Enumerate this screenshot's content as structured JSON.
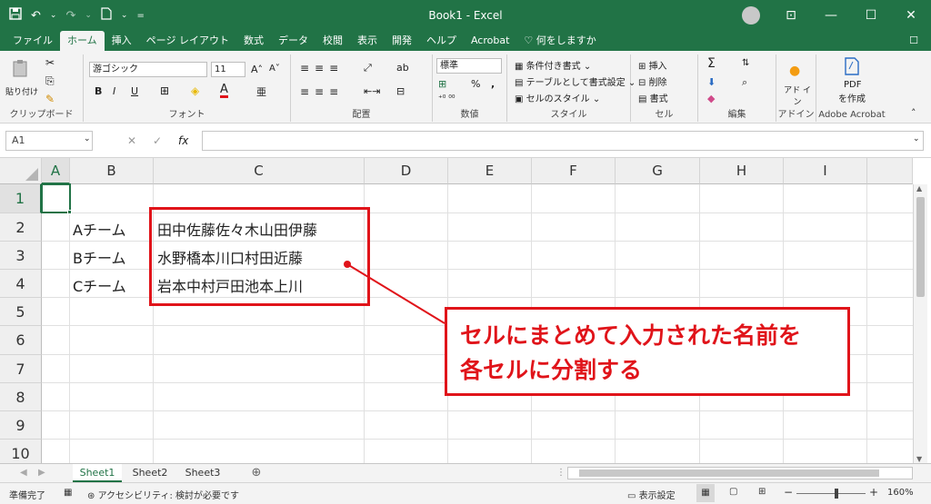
{
  "title_bar": {
    "title": "Book1  -  Excel",
    "minimize": "—",
    "restore": "☐",
    "close": "✕",
    "ribbon_display": "⊡"
  },
  "tabs": [
    "ファイル",
    "ホーム",
    "挿入",
    "ページ レイアウト",
    "数式",
    "データ",
    "校閲",
    "表示",
    "開発",
    "ヘルプ",
    "Acrobat"
  ],
  "tell_me": "何をしますか",
  "ribbon": {
    "clipboard": {
      "label": "クリップボード",
      "paste": "貼り付け"
    },
    "font": {
      "label": "フォント",
      "name": "游ゴシック",
      "size": "11",
      "bold": "B",
      "italic": "I",
      "underline": "U",
      "grow": "A˄",
      "shrink": "A˅"
    },
    "alignment": {
      "label": "配置"
    },
    "number": {
      "label": "数値",
      "format": "標準",
      "percent": "%",
      "comma": ","
    },
    "styles": {
      "label": "スタイル",
      "conditional": "条件付き書式",
      "table": "テーブルとして書式設定",
      "cell_styles": "セルのスタイル"
    },
    "cells": {
      "label": "セル",
      "insert": "挿入",
      "delete": "削除",
      "format": "書式"
    },
    "editing": {
      "label": "編集",
      "sum": "Σ"
    },
    "addins": {
      "label": "アドイン",
      "text": "アド イン"
    },
    "acrobat": {
      "label": "Adobe Acrobat",
      "pdf": "PDF",
      "create": "を作成"
    }
  },
  "formula_bar": {
    "name_box": "A1",
    "fx": "fx",
    "cancel": "✕",
    "enter": "✓"
  },
  "columns": [
    "A",
    "B",
    "C",
    "D",
    "E",
    "F",
    "G",
    "H",
    "I"
  ],
  "rows": [
    "1",
    "2",
    "3",
    "4",
    "5",
    "6",
    "7",
    "8",
    "9",
    "10"
  ],
  "cells": {
    "B2": "Aチーム",
    "C2": "田中佐藤佐々木山田伊藤",
    "B3": "Bチーム",
    "C3": "水野橋本川口村田近藤",
    "B4": "Cチーム",
    "C4": "岩本中村戸田池本上川"
  },
  "callout": {
    "line1": "セルにまとめて入力された名前を",
    "line2": "各セルに分割する"
  },
  "sheets": [
    "Sheet1",
    "Sheet2",
    "Sheet3"
  ],
  "add_sheet": "⊕",
  "status": {
    "ready": "準備完了",
    "accessibility": "アクセシビリティ: 検討が必要です",
    "display_settings": "表示設定",
    "zoom": "160%",
    "zoom_out": "−",
    "zoom_in": "+"
  },
  "colors": {
    "accent": "#217346",
    "annotation": "#e0141a"
  }
}
